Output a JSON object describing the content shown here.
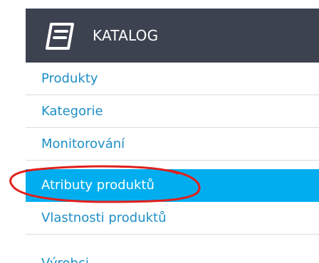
{
  "menu": {
    "header": {
      "title": "KATALOG",
      "icon": "notebook-icon"
    },
    "items": [
      {
        "label": "Produkty"
      },
      {
        "label": "Kategorie"
      },
      {
        "label": "Monitorování"
      },
      {
        "label": "Atributy produktů",
        "active": true
      },
      {
        "label": "Vlastnosti produktů"
      },
      {
        "label": "Výrobci"
      }
    ]
  },
  "colors": {
    "header_bg": "#3c4250",
    "active_bg": "#00aef0",
    "link": "#1e8fc6",
    "annotation": "#e0201b"
  }
}
